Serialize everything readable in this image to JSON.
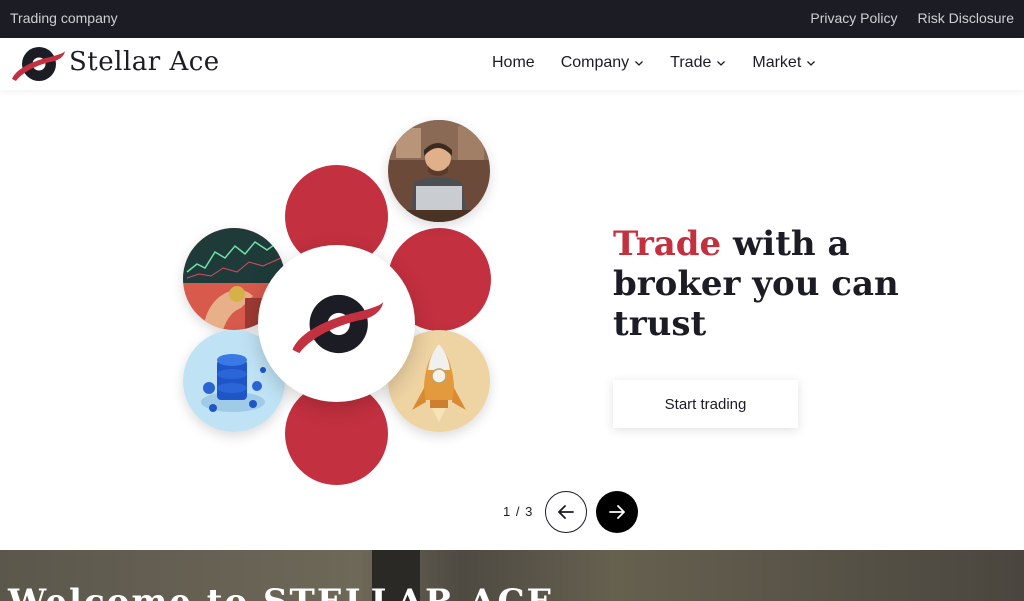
{
  "topbar": {
    "left_text": "Trading company",
    "links": [
      "Privacy Policy",
      "Risk Disclosure"
    ]
  },
  "header": {
    "brand": "Stellar Ace",
    "nav": [
      {
        "label": "Home",
        "has_dropdown": false
      },
      {
        "label": "Company",
        "has_dropdown": true
      },
      {
        "label": "Trade",
        "has_dropdown": true
      },
      {
        "label": "Market",
        "has_dropdown": true
      }
    ]
  },
  "hero": {
    "headline_accent": "Trade",
    "headline_rest": " with a broker you can trust",
    "cta_label": "Start trading",
    "pager": "1 / 3"
  },
  "bottom_band": {
    "title": "Welcome to STELLAR ACE"
  },
  "colors": {
    "accent": "#c3303f",
    "dark": "#1c1d24"
  }
}
